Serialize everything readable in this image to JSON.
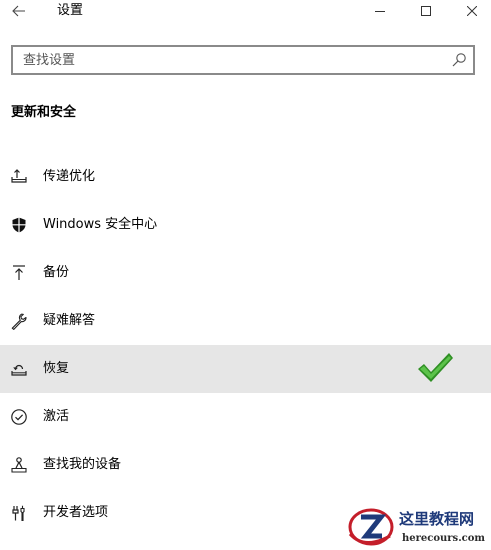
{
  "window": {
    "title": "设置"
  },
  "search": {
    "placeholder": "查找设置",
    "value": ""
  },
  "section": {
    "title": "更新和安全"
  },
  "nav": {
    "items": [
      {
        "label": "传递优化",
        "icon": "delivery-optimization-icon",
        "selected": false
      },
      {
        "label": "Windows 安全中心",
        "icon": "shield-icon",
        "selected": false
      },
      {
        "label": "备份",
        "icon": "backup-arrow-icon",
        "selected": false
      },
      {
        "label": "疑难解答",
        "icon": "wrench-icon",
        "selected": false
      },
      {
        "label": "恢复",
        "icon": "recovery-icon",
        "selected": true
      },
      {
        "label": "激活",
        "icon": "check-circle-icon",
        "selected": false
      },
      {
        "label": "查找我的设备",
        "icon": "find-device-icon",
        "selected": false
      },
      {
        "label": "开发者选项",
        "icon": "developer-tools-icon",
        "selected": false
      }
    ]
  },
  "annotation": {
    "icon": "green-checkmark-icon",
    "color": "#3a9d2f"
  },
  "watermark": {
    "title": "这里教程网",
    "url": "herecours.com"
  },
  "colors": {
    "selected_bg": "#e6e6e6",
    "search_border": "#8a8a8a"
  }
}
